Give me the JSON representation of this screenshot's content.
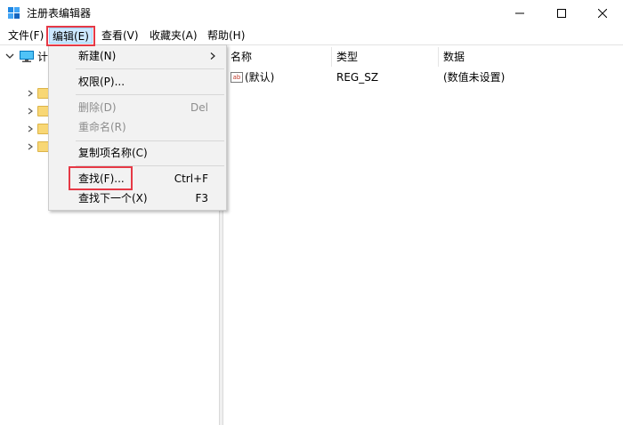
{
  "window": {
    "title": "注册表编辑器"
  },
  "menubar": {
    "items": [
      {
        "label": "文件(F)"
      },
      {
        "label": "编辑(E)"
      },
      {
        "label": "查看(V)"
      },
      {
        "label": "收藏夹(A)"
      },
      {
        "label": "帮助(H)"
      }
    ]
  },
  "tree": {
    "root_label": "计"
  },
  "list": {
    "columns": [
      "名称",
      "类型",
      "数据"
    ],
    "rows": [
      {
        "icon": "ab",
        "name": "(默认)",
        "type": "REG_SZ",
        "data": "(数值未设置)"
      }
    ]
  },
  "edit_menu": {
    "items": [
      {
        "label": "新建(N)",
        "shortcut": "",
        "submenu": true,
        "enabled": true
      },
      {
        "label": "权限(P)...",
        "shortcut": "",
        "enabled": true
      },
      {
        "label": "删除(D)",
        "shortcut": "Del",
        "enabled": false
      },
      {
        "label": "重命名(R)",
        "shortcut": "",
        "enabled": false
      },
      {
        "label": "复制项名称(C)",
        "shortcut": "",
        "enabled": true
      },
      {
        "label": "查找(F)...",
        "shortcut": "Ctrl+F",
        "enabled": true
      },
      {
        "label": "查找下一个(X)",
        "shortcut": "F3",
        "enabled": true
      }
    ]
  },
  "colors": {
    "highlight_box": "#e63946",
    "menu_selected": "#cce8ff",
    "folder": "#f8d775"
  }
}
